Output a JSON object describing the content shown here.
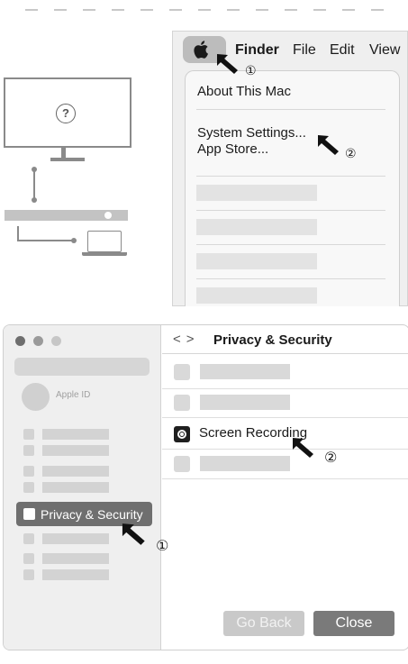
{
  "finder_menu": {
    "menubar": [
      "Finder",
      "File",
      "Edit",
      "View"
    ],
    "items": [
      "About This Mac",
      "System Settings...",
      "App Store..."
    ],
    "callouts": [
      "①",
      "②"
    ]
  },
  "illustration": {
    "monitor_symbol": "?"
  },
  "settings_window": {
    "sidebar": {
      "apple_id_label": "Apple ID",
      "selected_item": "Privacy & Security",
      "callout": "①"
    },
    "pane": {
      "title": "Privacy & Security",
      "nav_back": "<",
      "nav_forward": ">",
      "highlighted_row": "Screen Recording",
      "callout": "②"
    },
    "buttons": {
      "go_back": "Go Back",
      "close": "Close"
    }
  },
  "colors": {
    "accent_selected": "#6f6f6f",
    "close_button": "#7a7a7a",
    "go_back_button": "#c9c9c9"
  }
}
